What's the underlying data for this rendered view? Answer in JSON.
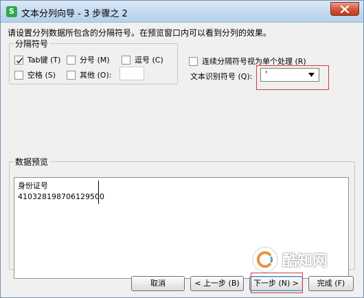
{
  "window": {
    "title": "文本分列向导 - 3 步骤之 2",
    "icon_letter": "S"
  },
  "instruction": "请设置分列数据所包含的分隔符号。在预览窗口内可以看到分列的效果。",
  "delimiters": {
    "legend": "分隔符号",
    "tab": {
      "label": "Tab键 (T)",
      "checked": true
    },
    "semicolon": {
      "label": "分号 (M)",
      "checked": false
    },
    "comma": {
      "label": "逗号 (C)",
      "checked": false
    },
    "space": {
      "label": "空格 (S)",
      "checked": false
    },
    "other": {
      "label": "其他 (O):",
      "checked": false,
      "value": ""
    }
  },
  "options": {
    "consecutive": {
      "label": "连续分隔符号视为单个处理 (R)",
      "checked": false
    },
    "qualifier_label": "文本识别符号 (Q):",
    "qualifier_value": "'"
  },
  "preview": {
    "legend": "数据预览",
    "rows": [
      "身份证号",
      "410328198706129500"
    ]
  },
  "buttons": {
    "cancel": "取消",
    "back": "< 上一步 (B)",
    "next": "下一步 (N) >",
    "finish": "完成 (F)"
  },
  "watermark": {
    "text": "酷知网"
  },
  "colors": {
    "highlight": "#d23a3a",
    "app_icon": "#2fa84f"
  }
}
